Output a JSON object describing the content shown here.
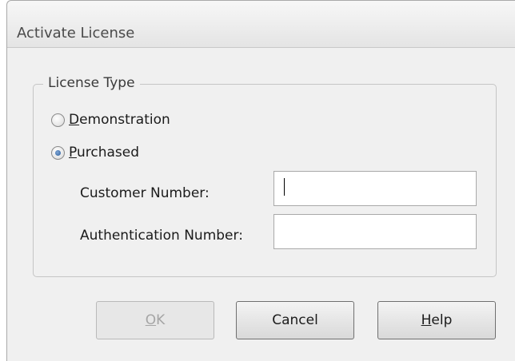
{
  "window": {
    "title": "Activate License"
  },
  "license_type": {
    "legend": "License Type",
    "options": [
      {
        "first": "D",
        "rest": "emonstration",
        "selected": false
      },
      {
        "first": "P",
        "rest": "urchased",
        "selected": true
      }
    ]
  },
  "fields": {
    "customer_number": {
      "label": "Customer Number:",
      "value": ""
    },
    "authentication_number": {
      "label": "Authentication Number:",
      "value": ""
    }
  },
  "buttons": {
    "ok": {
      "first": "O",
      "rest": "K",
      "enabled": false
    },
    "cancel": {
      "label": "Cancel"
    },
    "help": {
      "first": "H",
      "rest": "elp"
    }
  }
}
